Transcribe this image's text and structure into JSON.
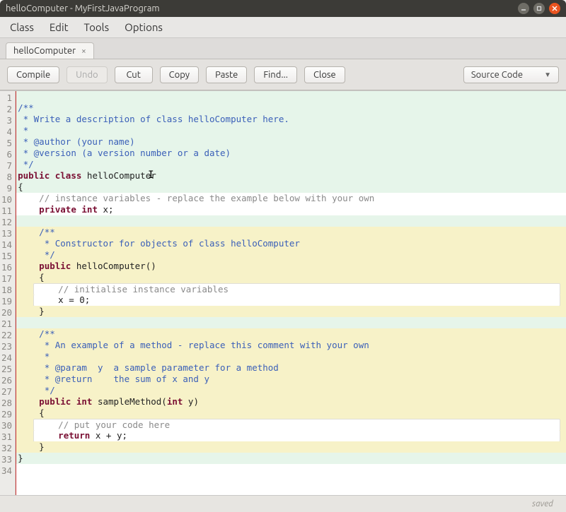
{
  "window": {
    "title": "helloComputer - MyFirstJavaProgram"
  },
  "menu": {
    "class": "Class",
    "edit": "Edit",
    "tools": "Tools",
    "options": "Options"
  },
  "tab": {
    "label": "helloComputer",
    "close": "×"
  },
  "toolbar": {
    "compile": "Compile",
    "undo": "Undo",
    "cut": "Cut",
    "copy": "Copy",
    "paste": "Paste",
    "find": "Find...",
    "close": "Close",
    "mode": "Source Code"
  },
  "gutter": [
    "1",
    "2",
    "3",
    "4",
    "5",
    "6",
    "7",
    "8",
    "9",
    "10",
    "11",
    "12",
    "13",
    "14",
    "15",
    "16",
    "17",
    "18",
    "19",
    "20",
    "21",
    "22",
    "23",
    "24",
    "25",
    "26",
    "27",
    "28",
    "29",
    "30",
    "31",
    "32",
    "33",
    "34"
  ],
  "code": {
    "l2": "/**",
    "l3": " * Write a description of class helloComputer here.",
    "l4": " * ",
    "l5": " * @author (your name) ",
    "l6": " * @version (a version number or a date)",
    "l7": " */",
    "l8a": "public",
    "l8b": "class",
    "l8c": "helloComputer",
    "l9": "{",
    "l10": "// instance variables - replace the example below with your own",
    "l11a": "private",
    "l11b": "int",
    "l11c": "x;",
    "l13": "/**",
    "l14": " * Constructor for objects of class helloComputer",
    "l15": " */",
    "l16a": "public",
    "l16b": "helloComputer()",
    "l17": "{",
    "l18": "// initialise instance variables",
    "l19": "x = 0;",
    "l20": "}",
    "l22": "/**",
    "l23": " * An example of a method - replace this comment with your own",
    "l24": " * ",
    "l25": " * @param  y  a sample parameter for a method",
    "l26": " * @return    the sum of x and y ",
    "l27": " */",
    "l28a": "public",
    "l28b": "int",
    "l28c": "sampleMethod(",
    "l28d": "int",
    "l28e": "y)",
    "l29": "{",
    "l30": "// put your code here",
    "l31a": "return",
    "l31b": "x + y;",
    "l32": "}",
    "l33": "}"
  },
  "status": {
    "text": "saved"
  }
}
